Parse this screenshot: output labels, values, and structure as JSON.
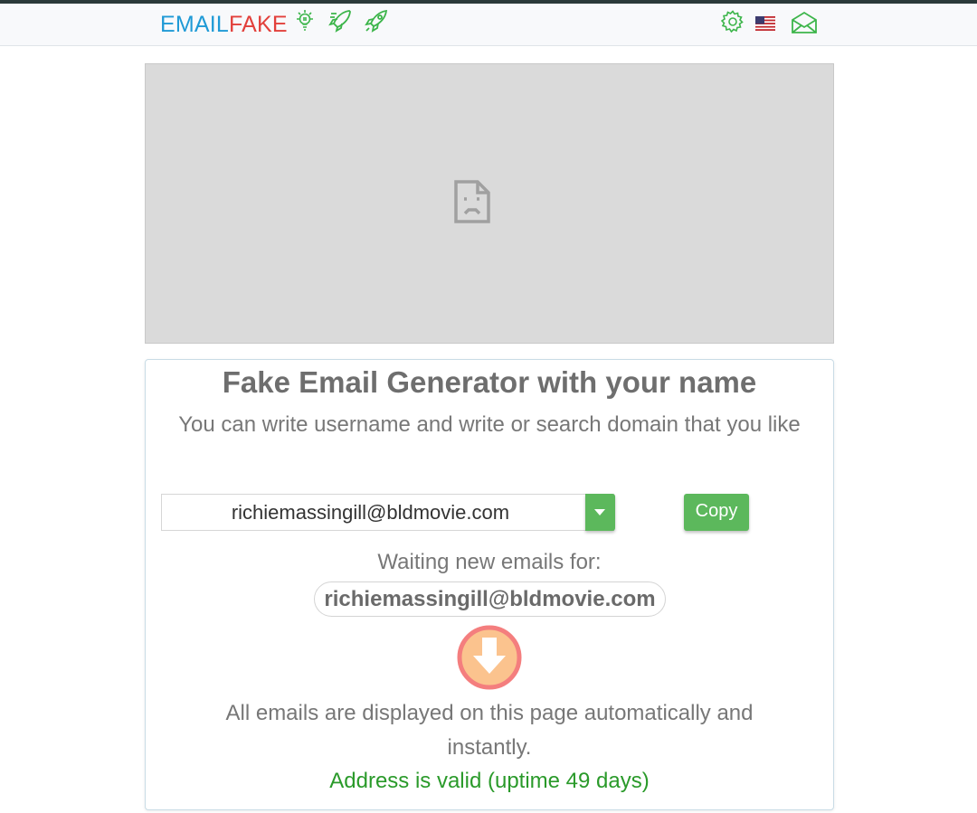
{
  "navbar": {
    "brand_part1": "EMAIL",
    "brand_part2": "FAKE",
    "icons": [
      "lightbulb-icon",
      "rocket-list-icon",
      "rocket-icon",
      "gear-icon",
      "us-flag-icon",
      "envelope-open-icon"
    ],
    "icon_color": "#3cb54a"
  },
  "ad": {
    "icon": "broken-image-icon"
  },
  "card": {
    "title": "Fake Email Generator with your name",
    "subtitle": "You can write username and write or search domain that you like",
    "username": "richiemassingill",
    "domain": "@bldmovie.com",
    "copy_label": "Copy",
    "waiting_label": "Waiting new emails for:",
    "current_email": "richiemassingill@bldmovie.com",
    "auto_text": "All emails are displayed on this page automatically and instantly.",
    "valid_text": "Address is valid (uptime 49 days)"
  },
  "colors": {
    "brand_blue": "#1f9ad6",
    "brand_red": "#e2403b",
    "button_green": "#5cb85c",
    "valid_green": "#2a9a2a"
  }
}
